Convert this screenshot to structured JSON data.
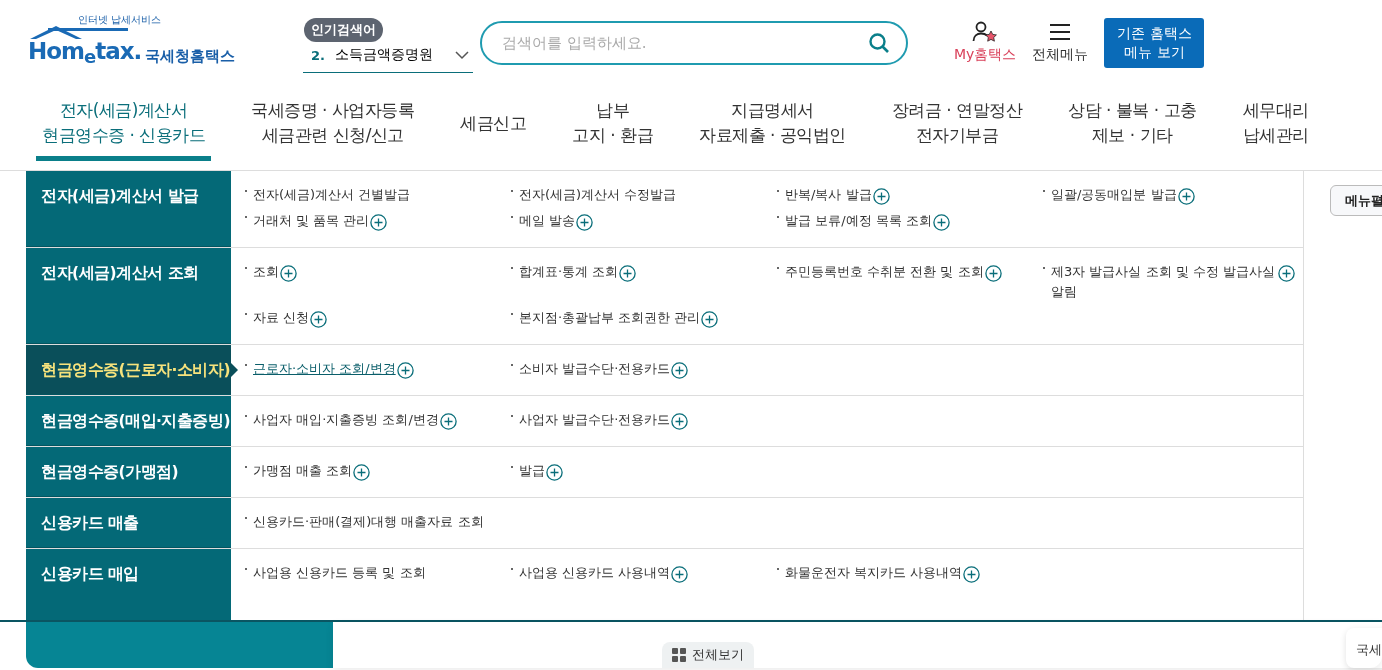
{
  "header": {
    "logo": {
      "tagline": "인터넷 납세서비스",
      "wordmark": "Hom$_{e}$tax.",
      "name": "국세청홈택스"
    },
    "popular": {
      "badge": "인기검색어",
      "rank": "2.",
      "term": "소득금액증명원"
    },
    "search": {
      "placeholder": "검색어를 입력하세요."
    },
    "my": "My홈택스",
    "all_menu": "전체메뉴",
    "classic_button": "기존 홈택스\n메뉴 보기"
  },
  "nav": [
    {
      "label": "전자(세금)계산서\n현금영수증 · 신용카드",
      "selected": true
    },
    {
      "label": "국세증명 · 사업자등록\n세금관련 신청/신고",
      "selected": false
    },
    {
      "label": "세금신고",
      "selected": false
    },
    {
      "label": "납부\n고지 · 환급",
      "selected": false
    },
    {
      "label": "지급명세서\n자료제출 · 공익법인",
      "selected": false
    },
    {
      "label": "장려금 · 연말정산\n전자기부금",
      "selected": false
    },
    {
      "label": "상담 · 불복 · 고충\n제보 · 기타",
      "selected": false
    },
    {
      "label": "세무대리\n납세관리",
      "selected": false
    }
  ],
  "mega_menu": {
    "categories": [
      {
        "title": "전자(세금)계산서 발급",
        "selected": false,
        "items": [
          {
            "label": "전자(세금)계산서 건별발급",
            "plus": false,
            "selected": false
          },
          {
            "label": "전자(세금)계산서 수정발급",
            "plus": false,
            "selected": false
          },
          {
            "label": "반복/복사 발급",
            "plus": true,
            "selected": false
          },
          {
            "label": "일괄/공동매입분 발급",
            "plus": true,
            "selected": false
          },
          {
            "label": "거래처 및 품목 관리",
            "plus": true,
            "selected": false
          },
          {
            "label": "메일 발송",
            "plus": true,
            "selected": false
          },
          {
            "label": "발급 보류/예정 목록 조회",
            "plus": true,
            "selected": false
          }
        ]
      },
      {
        "title": "전자(세금)계산서 조회",
        "selected": false,
        "items": [
          {
            "label": "조회",
            "plus": true,
            "selected": false
          },
          {
            "label": "합계표·통계 조회",
            "plus": true,
            "selected": false
          },
          {
            "label": "주민등록번호 수취분 전환 및 조회",
            "plus": true,
            "selected": false
          },
          {
            "label": "제3자 발급사실 조회 및 수정 발급사실 알림",
            "plus": true,
            "selected": false
          },
          {
            "label": "자료 신청",
            "plus": true,
            "selected": false
          },
          {
            "label": "본지점·총괄납부 조회권한 관리",
            "plus": true,
            "selected": false
          }
        ]
      },
      {
        "title": "현금영수증(근로자·소비자)",
        "selected": true,
        "items": [
          {
            "label": "근로자·소비자 조회/변경",
            "plus": true,
            "selected": true
          },
          {
            "label": "소비자 발급수단·전용카드",
            "plus": true,
            "selected": false
          }
        ]
      },
      {
        "title": "현금영수증(매입·지출증빙)",
        "selected": false,
        "items": [
          {
            "label": "사업자 매입·지출증빙 조회/변경",
            "plus": true,
            "selected": false
          },
          {
            "label": "사업자 발급수단·전용카드",
            "plus": true,
            "selected": false
          }
        ]
      },
      {
        "title": "현금영수증(가맹점)",
        "selected": false,
        "items": [
          {
            "label": "가맹점 매출 조회",
            "plus": true,
            "selected": false
          },
          {
            "label": "발급",
            "plus": true,
            "selected": false
          }
        ]
      },
      {
        "title": "신용카드 매출",
        "selected": false,
        "items": [
          {
            "label": "신용카드·판매(결제)대행 매출자료 조회",
            "plus": false,
            "selected": false
          }
        ]
      },
      {
        "title": "신용카드 매입",
        "selected": false,
        "items": [
          {
            "label": "사업용 신용카드 등록 및 조회",
            "plus": false,
            "selected": false
          },
          {
            "label": "사업용 신용카드 사용내역",
            "plus": true,
            "selected": false
          },
          {
            "label": "화물운전자 복지카드 사용내역",
            "plus": true,
            "selected": false
          }
        ]
      }
    ]
  },
  "side": {
    "button": "메뉴펼"
  },
  "bottom": {
    "all_view": "전체보기",
    "card": "국세"
  }
}
